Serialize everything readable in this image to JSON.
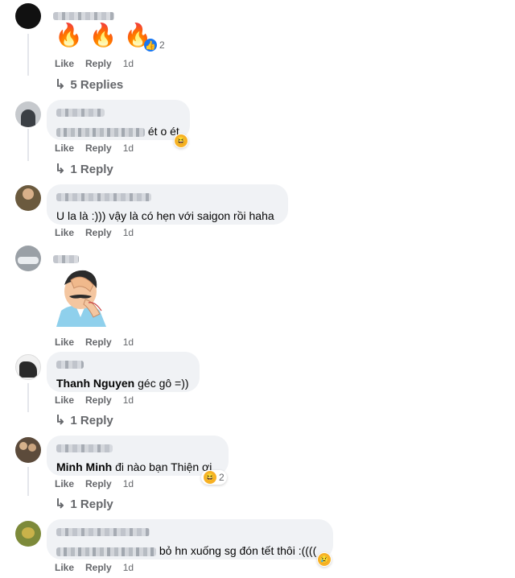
{
  "comments": [
    {
      "id": "c1",
      "fire": [
        "🔥",
        "🔥",
        "🔥"
      ],
      "reaction_count": "2",
      "like": "Like",
      "reply": "Reply",
      "time": "1d",
      "replies": "5 Replies",
      "colors": {
        "avatar": "#111111"
      }
    },
    {
      "id": "c2",
      "text": "ét o ét",
      "like": "Like",
      "reply": "Reply",
      "time": "1d",
      "replies": "1 Reply",
      "colors": {
        "avatar": "#6d7277"
      }
    },
    {
      "id": "c3",
      "text": "U la là :))) vậy là có hẹn với saigon rồi haha",
      "like": "Like",
      "reply": "Reply",
      "time": "1d",
      "colors": {
        "avatar": "#6b5a3e"
      }
    },
    {
      "id": "c4",
      "like": "Like",
      "reply": "Reply",
      "time": "1d",
      "colors": {
        "avatar": "#8c9097"
      }
    },
    {
      "id": "c5",
      "tag": "Thanh Nguyen",
      "text": "géc gô =))",
      "like": "Like",
      "reply": "Reply",
      "time": "1d",
      "replies": "1 Reply",
      "colors": {
        "avatar": "#2a2a2a"
      }
    },
    {
      "id": "c6",
      "tag": "Minh Minh",
      "text": "đi nào bạn Thiện ơi",
      "reaction_count": "2",
      "like": "Like",
      "reply": "Reply",
      "time": "1d",
      "replies": "1 Reply",
      "colors": {
        "avatar": "#5c4b3b"
      }
    },
    {
      "id": "c7",
      "text": "bỏ hn xuống sg đón tết thôi :((((",
      "like": "Like",
      "reply": "Reply",
      "time": "1d",
      "colors": {
        "avatar": "#7d8a3a"
      }
    }
  ]
}
